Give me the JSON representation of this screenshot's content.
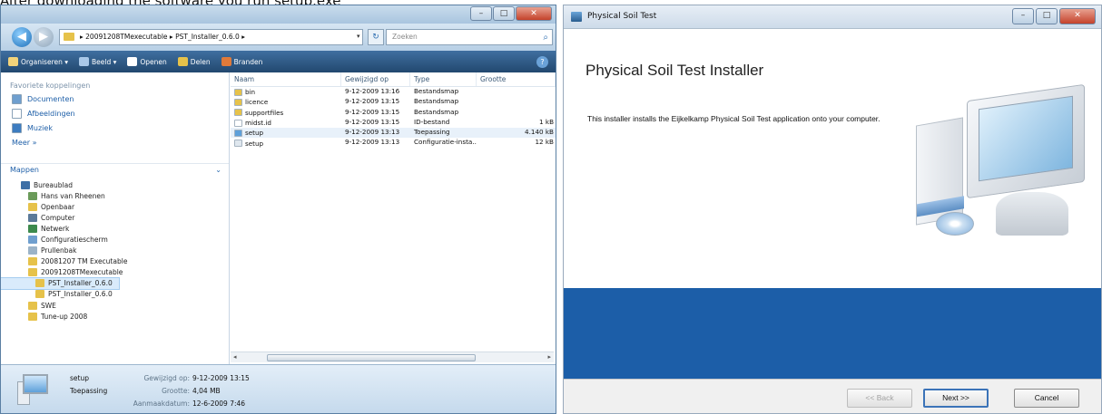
{
  "caption": "After downloading the software you run setup.exe",
  "explorer": {
    "breadcrumb": "▸ 20091208TMexecutable ▸ PST_Installer_0.6.0 ▸",
    "search_placeholder": "Zoeken",
    "commands": [
      {
        "label": "Organiseren ▾",
        "color": "#f2d37a"
      },
      {
        "label": "Beeld ▾",
        "color": "#a9c8e8"
      },
      {
        "label": "Openen",
        "color": "#ffffff"
      },
      {
        "label": "Delen",
        "color": "#e6c24a"
      },
      {
        "label": "Branden",
        "color": "#e07a3a"
      }
    ],
    "nav": {
      "favorites_header": "Favoriete koppelingen",
      "favorites": [
        {
          "label": "Documenten",
          "color": "#6f9fcf"
        },
        {
          "label": "Afbeeldingen",
          "color": "#ffffff"
        },
        {
          "label": "Muziek",
          "color": "#3d7cc0"
        },
        {
          "label": "Meer »",
          "color": ""
        }
      ],
      "folders_header": "Mappen",
      "tree": [
        {
          "label": "Bureaublad",
          "indent": 0,
          "color": "#3d6fa6"
        },
        {
          "label": "Hans van Rheenen",
          "indent": 1,
          "color": "#6b9b5a"
        },
        {
          "label": "Openbaar",
          "indent": 1,
          "color": "#e6c24a"
        },
        {
          "label": "Computer",
          "indent": 1,
          "color": "#5b7a99"
        },
        {
          "label": "Netwerk",
          "indent": 1,
          "color": "#3d8a4d"
        },
        {
          "label": "Configuratiescherm",
          "indent": 1,
          "color": "#6f9fcf"
        },
        {
          "label": "Prullenbak",
          "indent": 1,
          "color": "#9bb3c8"
        },
        {
          "label": "20081207 TM Executable",
          "indent": 1,
          "color": "#e6c24a"
        },
        {
          "label": "20091208TMexecutable",
          "indent": 1,
          "color": "#e6c24a"
        },
        {
          "label": "PST_Installer_0.6.0",
          "indent": 2,
          "color": "#e6c24a"
        },
        {
          "label": "PST_Installer_0.6.0",
          "indent": 2,
          "color": "#e6c24a"
        },
        {
          "label": "SWE",
          "indent": 1,
          "color": "#e6c24a"
        },
        {
          "label": "Tune-up 2008",
          "indent": 1,
          "color": "#e6c24a"
        }
      ]
    },
    "columns": [
      "Naam",
      "Gewijzigd op",
      "Type",
      "Grootte"
    ],
    "files": [
      {
        "name": "bin",
        "date": "9-12-2009 13:16",
        "type": "Bestandsmap",
        "size": "",
        "color": "#e6c24a"
      },
      {
        "name": "licence",
        "date": "9-12-2009 13:15",
        "type": "Bestandsmap",
        "size": "",
        "color": "#e6c24a"
      },
      {
        "name": "supportfiles",
        "date": "9-12-2009 13:15",
        "type": "Bestandsmap",
        "size": "",
        "color": "#e6c24a"
      },
      {
        "name": "midst.id",
        "date": "9-12-2009 13:15",
        "type": "ID-bestand",
        "size": "1 kB",
        "color": "#ffffff"
      },
      {
        "name": "setup",
        "date": "9-12-2009 13:13",
        "type": "Toepassing",
        "size": "4.140 kB",
        "color": "#5ea0da"
      },
      {
        "name": "setup",
        "date": "9-12-2009 13:13",
        "type": "Configuratie-insta...",
        "size": "12 kB",
        "color": "#dfe7ee"
      }
    ],
    "details": {
      "name": "setup",
      "type": "Toepassing",
      "modified_label": "Gewijzigd op:",
      "modified": "9-12-2009 13:15",
      "size_label": "Grootte:",
      "size": "4,04 MB",
      "created_label": "Aanmaakdatum:",
      "created": "12-6-2009 7:46"
    }
  },
  "installer": {
    "title": "Physical Soil Test",
    "heading": "Physical Soil Test Installer",
    "description": "This installer installs the Eijkelkamp Physical Soil Test application onto your computer.",
    "buttons": {
      "back": "<< Back",
      "next": "Next >>",
      "cancel": "Cancel"
    }
  }
}
